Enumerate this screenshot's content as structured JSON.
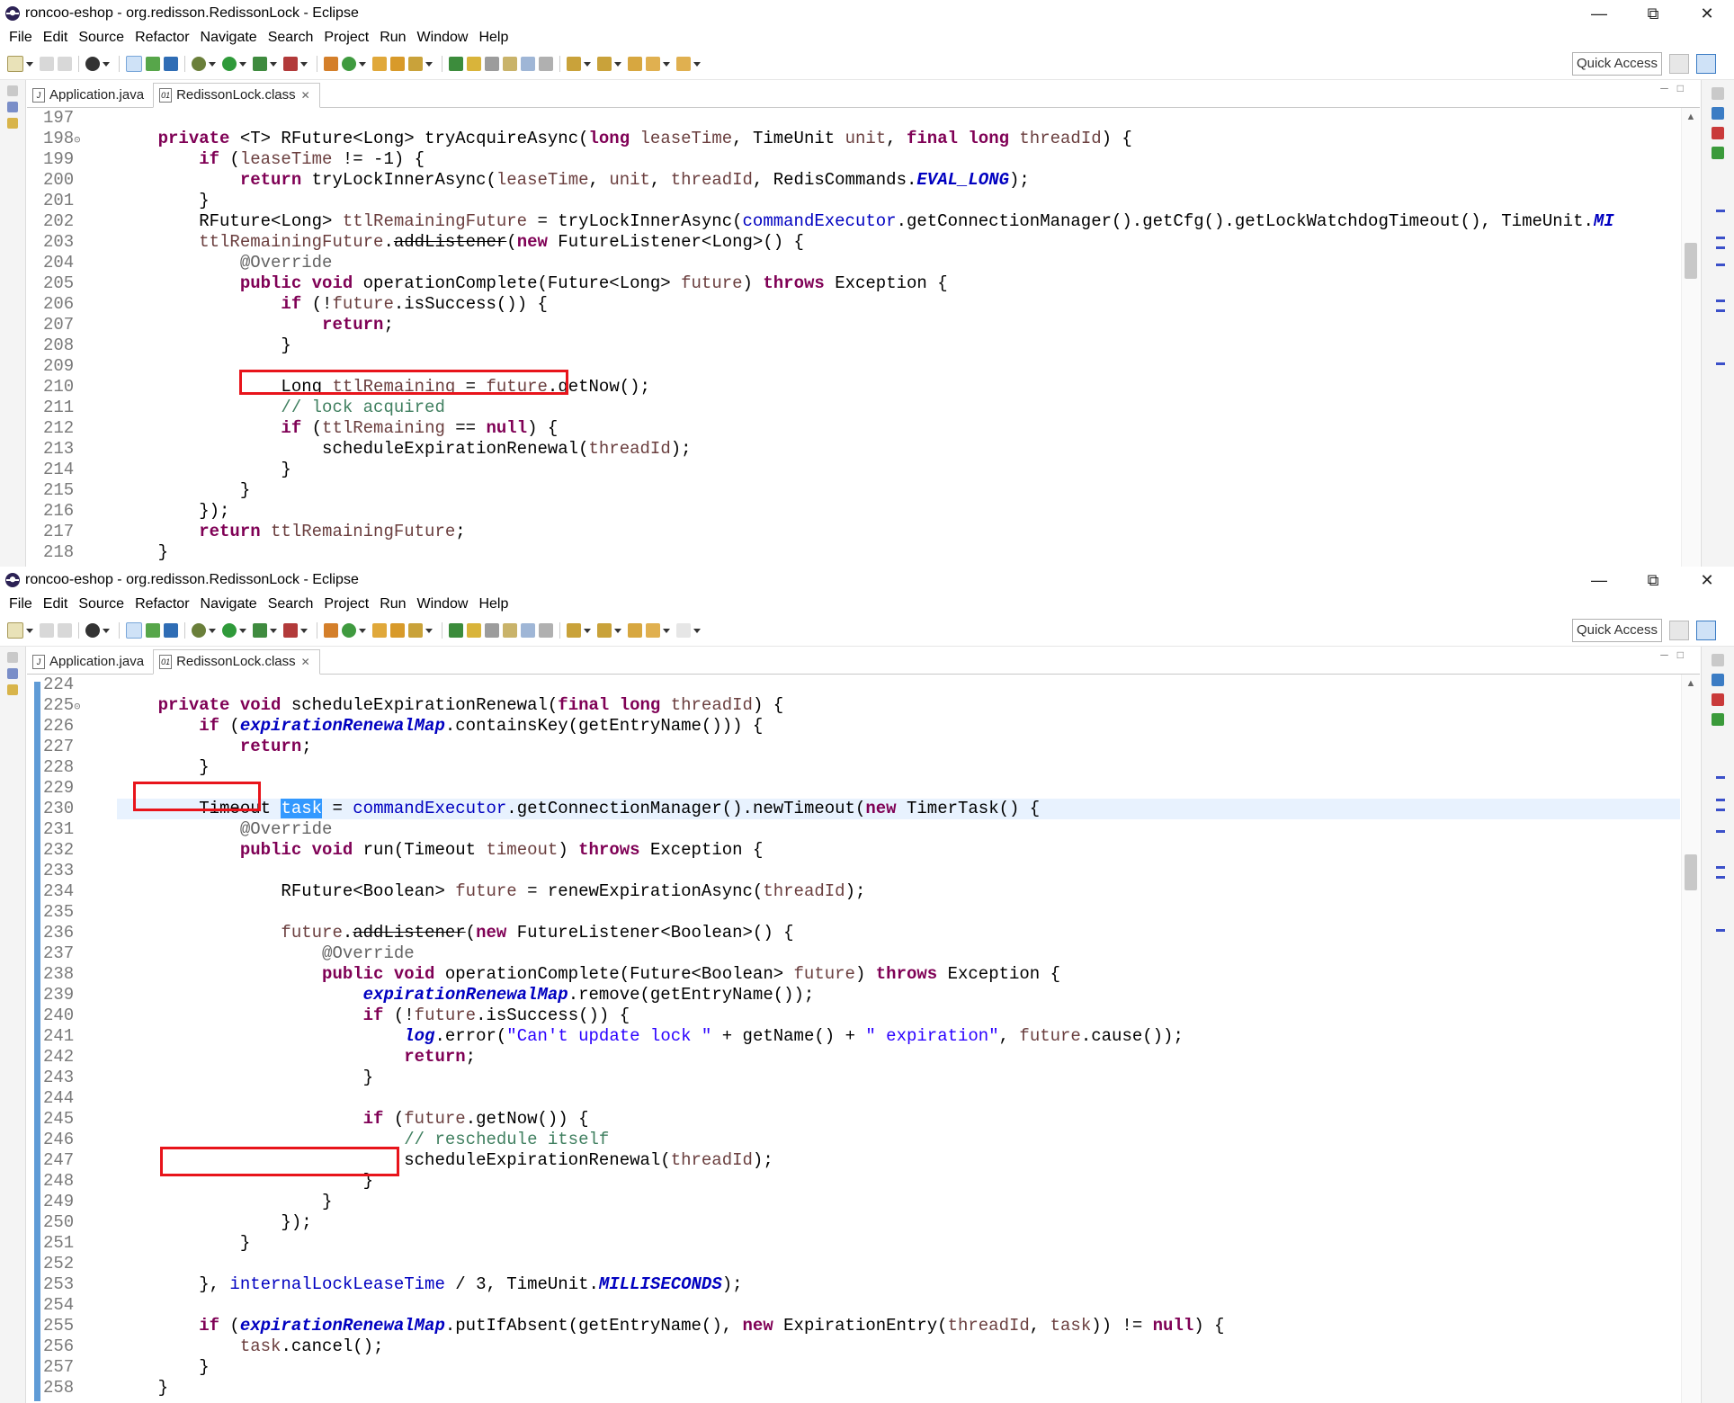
{
  "windows": [
    {
      "title": "roncoo-eshop - org.redisson.RedissonLock - Eclipse",
      "menu": [
        "File",
        "Edit",
        "Source",
        "Refactor",
        "Navigate",
        "Search",
        "Project",
        "Run",
        "Window",
        "Help"
      ],
      "quick_access": "Quick Access",
      "tabs": [
        {
          "label": "Application.java",
          "active": false
        },
        {
          "label": "RedissonLock.class",
          "active": true
        }
      ],
      "line_numbers": [
        "197",
        "198",
        "199",
        "200",
        "201",
        "202",
        "203",
        "204",
        "205",
        "206",
        "207",
        "208",
        "209",
        "210",
        "211",
        "212",
        "213",
        "214",
        "215",
        "216",
        "217",
        "218"
      ]
    },
    {
      "title": "roncoo-eshop - org.redisson.RedissonLock - Eclipse",
      "menu": [
        "File",
        "Edit",
        "Source",
        "Refactor",
        "Navigate",
        "Search",
        "Project",
        "Run",
        "Window",
        "Help"
      ],
      "quick_access": "Quick Access",
      "tabs": [
        {
          "label": "Application.java",
          "active": false
        },
        {
          "label": "RedissonLock.class",
          "active": true
        }
      ],
      "line_numbers": [
        "224",
        "225",
        "226",
        "227",
        "228",
        "229",
        "230",
        "231",
        "232",
        "233",
        "234",
        "235",
        "236",
        "237",
        "238",
        "239",
        "240",
        "241",
        "242",
        "243",
        "244",
        "245",
        "246",
        "247",
        "248",
        "249",
        "250",
        "251",
        "252",
        "253",
        "254",
        "255",
        "256",
        "257",
        "258"
      ]
    }
  ],
  "code1": [
    [],
    [
      [
        "kw",
        "    private "
      ],
      [
        "",
        "<T> RFuture<Long> tryAcquireAsync("
      ],
      [
        "kw",
        "long "
      ],
      [
        "var",
        "leaseTime"
      ],
      [
        "",
        ", TimeUnit "
      ],
      [
        "var",
        "unit"
      ],
      [
        "",
        ", "
      ],
      [
        "kw",
        "final long "
      ],
      [
        "var",
        "threadId"
      ],
      [
        "",
        ") {"
      ]
    ],
    [
      [
        "kw",
        "        if "
      ],
      [
        "",
        "("
      ],
      [
        "var",
        "leaseTime"
      ],
      [
        "",
        " != -1) {"
      ]
    ],
    [
      [
        "kw",
        "            return "
      ],
      [
        "",
        "tryLockInnerAsync("
      ],
      [
        "var",
        "leaseTime"
      ],
      [
        "",
        ", "
      ],
      [
        "var",
        "unit"
      ],
      [
        "",
        ", "
      ],
      [
        "var",
        "threadId"
      ],
      [
        "",
        ", RedisCommands."
      ],
      [
        "sfld",
        "EVAL_LONG"
      ],
      [
        "",
        ");"
      ]
    ],
    [
      [
        "",
        "        }"
      ]
    ],
    [
      [
        "",
        "        RFuture<Long> "
      ],
      [
        "var",
        "ttlRemainingFuture"
      ],
      [
        "",
        " = tryLockInnerAsync("
      ],
      [
        "fld",
        "commandExecutor"
      ],
      [
        "",
        ".getConnectionManager().getCfg().getLockWatchdogTimeout(), TimeUnit."
      ],
      [
        "sfld",
        "MI"
      ]
    ],
    [
      [
        "var",
        "        ttlRemainingFuture"
      ],
      [
        "",
        "."
      ],
      [
        "dep",
        "addListener"
      ],
      [
        "",
        "("
      ],
      [
        "kw",
        "new "
      ],
      [
        "",
        "FutureListener<Long>() {"
      ]
    ],
    [
      [
        "ann",
        "            @Override"
      ]
    ],
    [
      [
        "kw",
        "            public void "
      ],
      [
        "",
        "operationComplete(Future<Long> "
      ],
      [
        "var",
        "future"
      ],
      [
        "",
        ") "
      ],
      [
        "kw",
        "throws "
      ],
      [
        "",
        "Exception {"
      ]
    ],
    [
      [
        "kw",
        "                if "
      ],
      [
        "",
        "(!"
      ],
      [
        "var",
        "future"
      ],
      [
        "",
        ".isSuccess()) {"
      ]
    ],
    [
      [
        "kw",
        "                    return"
      ],
      [
        "",
        ";"
      ]
    ],
    [
      [
        "",
        "                }"
      ]
    ],
    [],
    [
      [
        "",
        "                Long "
      ],
      [
        "var",
        "ttlRemaining"
      ],
      [
        "",
        " = "
      ],
      [
        "var",
        "future"
      ],
      [
        "",
        ".getNow();"
      ]
    ],
    [
      [
        "cmt",
        "                // lock acquired"
      ]
    ],
    [
      [
        "kw",
        "                if "
      ],
      [
        "",
        "("
      ],
      [
        "var",
        "ttlRemaining"
      ],
      [
        "",
        " == "
      ],
      [
        "kw",
        "null"
      ],
      [
        "",
        ") {"
      ]
    ],
    [
      [
        "",
        "                    scheduleExpirationRenewal("
      ],
      [
        "var",
        "threadId"
      ],
      [
        "",
        ");"
      ]
    ],
    [
      [
        "",
        "                }"
      ]
    ],
    [
      [
        "",
        "            }"
      ]
    ],
    [
      [
        "",
        "        });"
      ]
    ],
    [
      [
        "kw",
        "        return "
      ],
      [
        "var",
        "ttlRemainingFuture"
      ],
      [
        "",
        ";"
      ]
    ],
    [
      [
        "",
        "    }"
      ]
    ]
  ],
  "code2": [
    [],
    [
      [
        "kw",
        "    private void "
      ],
      [
        "",
        "scheduleExpirationRenewal("
      ],
      [
        "kw",
        "final long "
      ],
      [
        "var",
        "threadId"
      ],
      [
        "",
        ") {"
      ]
    ],
    [
      [
        "kw",
        "        if "
      ],
      [
        "",
        "("
      ],
      [
        "sfld",
        "expirationRenewalMap"
      ],
      [
        "",
        ".containsKey(getEntryName())) {"
      ]
    ],
    [
      [
        "kw",
        "            return"
      ],
      [
        "",
        ";"
      ]
    ],
    [
      [
        "",
        "        }"
      ]
    ],
    [],
    [
      [
        "",
        "        Timeout "
      ],
      [
        "sel",
        "task"
      ],
      [
        "",
        " = "
      ],
      [
        "fld",
        "commandExecutor"
      ],
      [
        "",
        ".getConnectionManager().newTimeout("
      ],
      [
        "kw",
        "new "
      ],
      [
        "",
        "TimerTask() {"
      ]
    ],
    [
      [
        "ann",
        "            @Override"
      ]
    ],
    [
      [
        "kw",
        "            public void "
      ],
      [
        "",
        "run(Timeout "
      ],
      [
        "var",
        "timeout"
      ],
      [
        "",
        ") "
      ],
      [
        "kw",
        "throws "
      ],
      [
        "",
        "Exception {"
      ]
    ],
    [],
    [
      [
        "",
        "                RFuture<Boolean> "
      ],
      [
        "var",
        "future"
      ],
      [
        "",
        " = renewExpirationAsync("
      ],
      [
        "var",
        "threadId"
      ],
      [
        "",
        ");"
      ]
    ],
    [],
    [
      [
        "var",
        "                future"
      ],
      [
        "",
        "."
      ],
      [
        "dep",
        "addListener"
      ],
      [
        "",
        "("
      ],
      [
        "kw",
        "new "
      ],
      [
        "",
        "FutureListener<Boolean>() {"
      ]
    ],
    [
      [
        "ann",
        "                    @Override"
      ]
    ],
    [
      [
        "kw",
        "                    public void "
      ],
      [
        "",
        "operationComplete(Future<Boolean> "
      ],
      [
        "var",
        "future"
      ],
      [
        "",
        ") "
      ],
      [
        "kw",
        "throws "
      ],
      [
        "",
        "Exception {"
      ]
    ],
    [
      [
        "sfld",
        "                        expirationRenewalMap"
      ],
      [
        "",
        ".remove(getEntryName());"
      ]
    ],
    [
      [
        "kw",
        "                        if "
      ],
      [
        "",
        "(!"
      ],
      [
        "var",
        "future"
      ],
      [
        "",
        ".isSuccess()) {"
      ]
    ],
    [
      [
        "sfld",
        "                            log"
      ],
      [
        "",
        ".error("
      ],
      [
        "str",
        "\"Can't update lock \""
      ],
      [
        "",
        " + getName() + "
      ],
      [
        "str",
        "\" expiration\""
      ],
      [
        "",
        ", "
      ],
      [
        "var",
        "future"
      ],
      [
        "",
        ".cause());"
      ]
    ],
    [
      [
        "kw",
        "                            return"
      ],
      [
        "",
        ";"
      ]
    ],
    [
      [
        "",
        "                        }"
      ]
    ],
    [],
    [
      [
        "kw",
        "                        if "
      ],
      [
        "",
        "("
      ],
      [
        "var",
        "future"
      ],
      [
        "",
        ".getNow()) {"
      ]
    ],
    [
      [
        "cmt",
        "                            // reschedule itself"
      ]
    ],
    [
      [
        "",
        "                            scheduleExpirationRenewal("
      ],
      [
        "var",
        "threadId"
      ],
      [
        "",
        ");"
      ]
    ],
    [
      [
        "",
        "                        }"
      ]
    ],
    [
      [
        "",
        "                    }"
      ]
    ],
    [
      [
        "",
        "                });"
      ]
    ],
    [
      [
        "",
        "            }"
      ]
    ],
    [],
    [
      [
        "",
        "        }, "
      ],
      [
        "fld",
        "internalLockLeaseTime"
      ],
      [
        "",
        " / 3, TimeUnit."
      ],
      [
        "sfld",
        "MILLISECONDS"
      ],
      [
        "",
        ");"
      ]
    ],
    [],
    [
      [
        "kw",
        "        if "
      ],
      [
        "",
        "("
      ],
      [
        "sfld",
        "expirationRenewalMap"
      ],
      [
        "",
        ".putIfAbsent(getEntryName(), "
      ],
      [
        "kw",
        "new "
      ],
      [
        "",
        "ExpirationEntry("
      ],
      [
        "var",
        "threadId"
      ],
      [
        "",
        ", "
      ],
      [
        "var",
        "task"
      ],
      [
        "",
        ")) != "
      ],
      [
        "kw",
        "null"
      ],
      [
        "",
        ") {"
      ]
    ],
    [
      [
        "var",
        "            task"
      ],
      [
        "",
        ".cancel();"
      ]
    ],
    [
      [
        "",
        "        }"
      ]
    ],
    [
      [
        "",
        "    }"
      ]
    ]
  ],
  "colors": {
    "keyword": "#7f0055",
    "field": "#0000c0",
    "comment": "#3f7f5f",
    "string": "#2a00ff",
    "annotation": "#646464",
    "local_var": "#6a3e3e",
    "highlight_box": "#e8141b",
    "selection": "#3399ff"
  }
}
